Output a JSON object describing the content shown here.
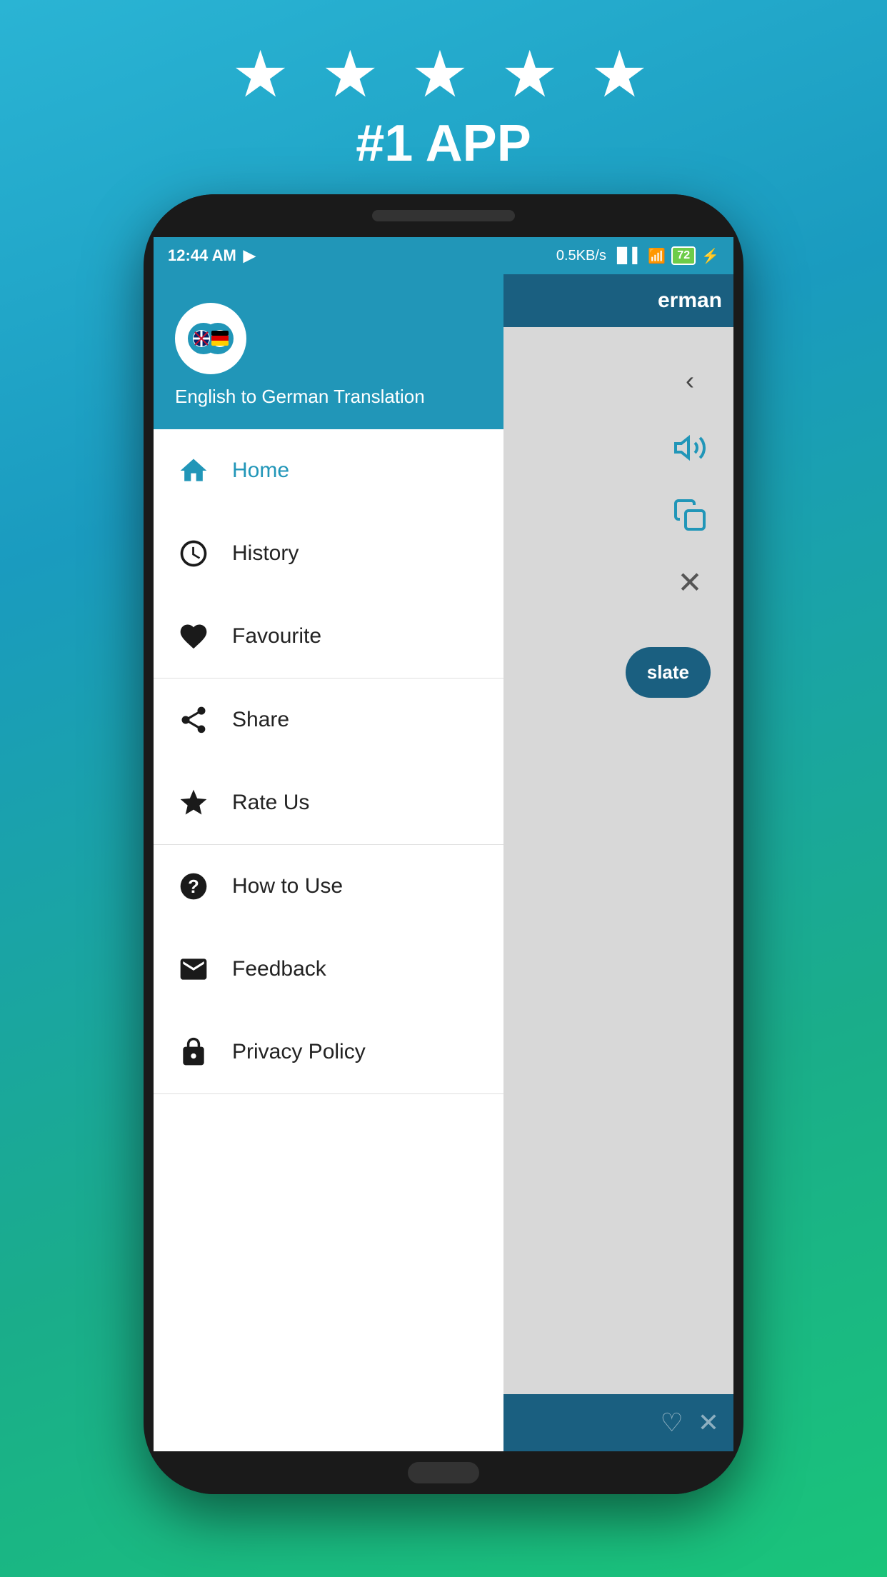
{
  "topBadge": {
    "stars": "★ ★ ★ ★ ★",
    "label": "#1 APP"
  },
  "statusBar": {
    "time": "12:44 AM",
    "networkSpeed": "0.5KB/s",
    "battery": "72"
  },
  "drawer": {
    "logoEmoji": "💬",
    "title": "English to German Translation",
    "menuItems": [
      {
        "id": "home",
        "label": "Home",
        "iconType": "home",
        "active": true
      },
      {
        "id": "history",
        "label": "History",
        "iconType": "clock",
        "active": false
      },
      {
        "id": "favourite",
        "label": "Favourite",
        "iconType": "heart",
        "active": false
      },
      {
        "id": "share",
        "label": "Share",
        "iconType": "share",
        "active": false
      },
      {
        "id": "rate-us",
        "label": "Rate Us",
        "iconType": "star",
        "active": false
      },
      {
        "id": "how-to-use",
        "label": "How to Use",
        "iconType": "question",
        "active": false
      },
      {
        "id": "feedback",
        "label": "Feedback",
        "iconType": "envelope",
        "active": false
      },
      {
        "id": "privacy-policy",
        "label": "Privacy Policy",
        "iconType": "lock",
        "active": false
      }
    ]
  },
  "mainPanel": {
    "headerTitle": "erman",
    "translateButton": "slate"
  }
}
